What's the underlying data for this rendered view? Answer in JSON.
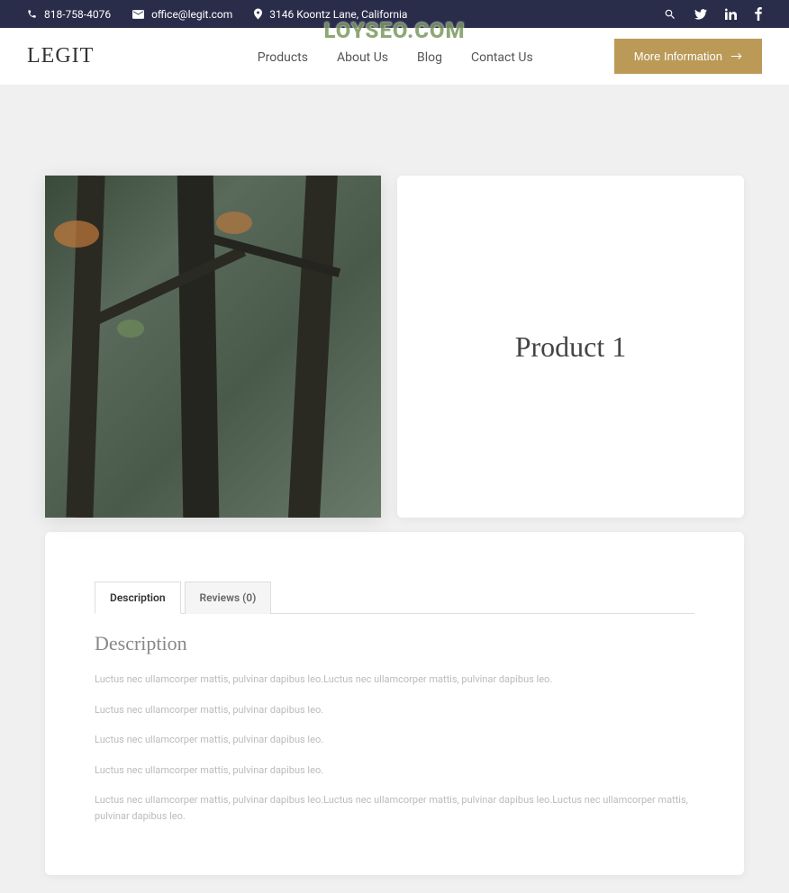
{
  "topbar": {
    "phone": "818-758-4076",
    "email": "office@legit.com",
    "address": "3146 Koontz Lane, California"
  },
  "watermark": "LOYSEO.COM",
  "nav": {
    "logo": "LEGIT",
    "items": [
      "Products",
      "About Us",
      "Blog",
      "Contact Us"
    ],
    "cta": "More Information"
  },
  "product": {
    "title": "Product 1"
  },
  "tabs": {
    "description": "Description",
    "reviews": "Reviews (0)"
  },
  "description": {
    "heading": "Description",
    "p1": "Luctus nec ullamcorper mattis, pulvinar dapibus leo.Luctus nec ullamcorper mattis, pulvinar dapibus leo.",
    "p2": "Luctus nec ullamcorper mattis, pulvinar dapibus leo.",
    "p3": "Luctus nec ullamcorper mattis, pulvinar dapibus leo.",
    "p4": "Luctus nec ullamcorper mattis, pulvinar dapibus leo.",
    "p5": "Luctus nec ullamcorper mattis, pulvinar dapibus leo.Luctus nec ullamcorper mattis, pulvinar dapibus leo.Luctus nec ullamcorper mattis, pulvinar dapibus leo."
  }
}
